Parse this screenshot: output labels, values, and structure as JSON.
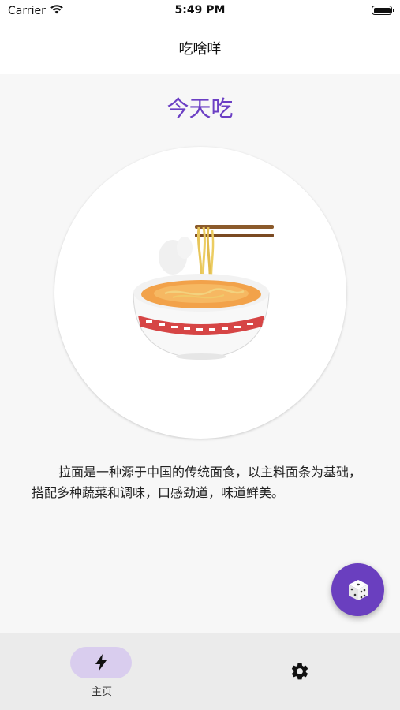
{
  "status": {
    "carrier": "Carrier",
    "time": "5:49 PM",
    "wifi_icon": "wifi-icon",
    "battery_icon": "battery-icon"
  },
  "app": {
    "title": "吃啥咩"
  },
  "main": {
    "headline": "今天吃",
    "food_image": "ramen-bowl-image",
    "description": "拉面是一种源于中国的传统面食，以主料面条为基础，搭配多种蔬菜和调味，口感劲道，味道鲜美。",
    "fab_icon": "dice-icon"
  },
  "nav": {
    "home_label": "主页",
    "home_icon": "lightning-icon",
    "settings_icon": "gear-icon"
  },
  "colors": {
    "accent": "#6a3fbf",
    "headline": "#6b3fc4",
    "nav_pill": "#d9cdee",
    "nav_background": "#ebebeb"
  }
}
